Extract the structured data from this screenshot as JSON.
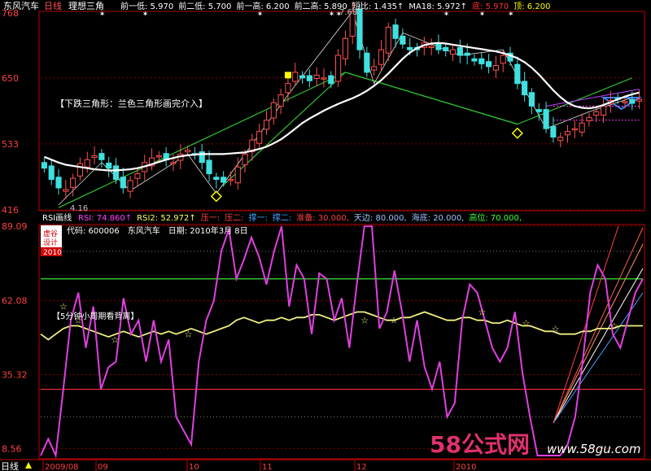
{
  "top_panel": {
    "stock_name": "东风汽车",
    "period": "日线",
    "indicator_name": "理想三角",
    "readouts": [
      {
        "label": "前一低:",
        "value": "5.970",
        "color": "#ffffff"
      },
      {
        "label": "前二低:",
        "value": "5.700",
        "color": "#ffffff"
      },
      {
        "label": "前一高:",
        "value": "6.200",
        "color": "#ffffff"
      },
      {
        "label": "前二高:",
        "value": "5.890",
        "color": "#ffffff"
      },
      {
        "label": "短比:",
        "value": "1.435↑",
        "color": "#ffffff"
      },
      {
        "label": "MA18:",
        "value": "5.972↑",
        "color": "#ffffff"
      },
      {
        "label": "底:",
        "value": "5.970",
        "color": "#ff3030"
      },
      {
        "label": "顶:",
        "value": "6.200",
        "color": "#ffff00"
      }
    ],
    "annotation": "【下跌三角形：兰色三角形画完介入】",
    "high_label": "7.68",
    "low_label": "4.16"
  },
  "bottom_panel": {
    "indicator_name": "RSI画线",
    "readouts": [
      {
        "label": "RSI:",
        "value": "74.860↑",
        "color": "#ff40ff"
      },
      {
        "label": "RSI2:",
        "value": "52.972↑",
        "color": "#ffff60"
      },
      {
        "label": "压一:",
        "value": "",
        "color": "#ff4040"
      },
      {
        "label": "压二:",
        "value": "",
        "color": "#ff4040"
      },
      {
        "label": "撑一:",
        "value": "",
        "color": "#40a0ff"
      },
      {
        "label": "撑二:",
        "value": "",
        "color": "#40a0ff"
      },
      {
        "label": "准备:",
        "value": "30.000,",
        "color": "#ff4040"
      },
      {
        "label": "天边:",
        "value": "80.000,",
        "color": "#a0c0ff"
      },
      {
        "label": "海底:",
        "value": "20.000,",
        "color": "#a0c0ff"
      },
      {
        "label": "高位:",
        "value": "70.000,",
        "color": "#40ff40"
      }
    ],
    "code_line": "代码: 600006　东风汽车　日期: 2010年3月 8日",
    "annotation": "【5分钟小周期看背离】",
    "badge_line1": "虚谷",
    "badge_line2": "设计",
    "badge_year": "2010"
  },
  "watermark": {
    "main": "58公式网",
    "url": "www.58gu.com"
  },
  "footer": {
    "period": "日线",
    "dates": [
      "2009/08",
      "09",
      "10",
      "11",
      "12",
      "2010"
    ]
  },
  "colors": {
    "bull": "#ff5050",
    "bear": "#40e0e0",
    "ma": "#ffffff",
    "rsi": "#e040e0",
    "rsi2": "#f0f080",
    "tri_green": "#30c030",
    "grid_red": "#a00000",
    "axis": "#c00000"
  },
  "chart_data": [
    {
      "type": "candlestick",
      "title": "东风汽车 日线 理想三角",
      "y_axis_ticks": [
        416,
        533,
        650,
        768
      ],
      "ylim": [
        416,
        768
      ],
      "annotations": [
        "7.68",
        "4.16"
      ],
      "series": [
        {
          "name": "MA18",
          "values": [
            510,
            505,
            500,
            496,
            494,
            492,
            490,
            488,
            487,
            486,
            486,
            487,
            488,
            490,
            493,
            497,
            501,
            505,
            508,
            511,
            513,
            514,
            515,
            515,
            515,
            515,
            516,
            517,
            518,
            521,
            524,
            528,
            534,
            541,
            550,
            560,
            570,
            578,
            585,
            592,
            598,
            604,
            609,
            614,
            620,
            627,
            636,
            646,
            658,
            671,
            684,
            695,
            703,
            708,
            711,
            712,
            711,
            709,
            707,
            705,
            703,
            701,
            699,
            697,
            694,
            690,
            685,
            678,
            668,
            656,
            642,
            628,
            616,
            606,
            600,
            597,
            596,
            598,
            602,
            607,
            612,
            617,
            621,
            624
          ]
        },
        {
          "name": "close",
          "values": [
            490,
            470,
            455,
            452,
            472,
            498,
            505,
            512,
            505,
            490,
            470,
            455,
            468,
            480,
            500,
            508,
            512,
            505,
            500,
            515,
            522,
            515,
            500,
            480,
            470,
            465,
            470,
            492,
            515,
            540,
            555,
            575,
            606,
            620,
            640,
            660,
            650,
            645,
            655,
            650,
            640,
            690,
            720,
            768,
            700,
            660,
            670,
            700,
            740,
            720,
            710,
            700,
            700,
            712,
            706,
            700,
            698,
            700,
            690,
            690,
            680,
            675,
            670,
            672,
            690,
            680,
            640,
            620,
            600,
            590,
            560,
            545,
            545,
            555,
            560,
            570,
            580,
            590,
            600,
            610,
            612,
            608,
            605,
            612
          ]
        }
      ]
    },
    {
      "type": "line",
      "title": "RSI画线",
      "y_axis_ticks": [
        8.56,
        35.32,
        62.08,
        89.09
      ],
      "ylim": [
        6,
        89.09
      ],
      "series": [
        {
          "name": "RSI",
          "values": [
            5,
            12,
            2,
            30,
            55,
            65,
            45,
            60,
            30,
            38,
            40,
            63,
            50,
            55,
            40,
            55,
            40,
            48,
            20,
            15,
            10,
            40,
            55,
            62,
            80,
            88,
            70,
            77,
            85,
            78,
            68,
            80,
            89,
            60,
            75,
            70,
            50,
            72,
            70,
            55,
            63,
            45,
            68,
            89,
            90,
            52,
            58,
            73,
            58,
            40,
            55,
            38,
            30,
            40,
            20,
            25,
            55,
            68,
            65,
            55,
            45,
            40,
            45,
            58,
            36,
            20,
            0,
            -5,
            -3,
            0,
            10,
            20,
            40,
            65,
            75,
            70,
            50,
            45,
            55,
            65,
            70
          ]
        },
        {
          "name": "RSI2",
          "values": [
            50,
            48,
            50,
            52,
            53,
            53,
            52,
            51,
            50,
            49,
            50,
            51,
            50,
            49,
            50,
            51,
            50,
            51,
            50,
            51,
            52,
            51,
            50,
            51,
            52,
            53,
            55,
            56,
            55,
            54,
            55,
            55,
            56,
            55,
            56,
            56,
            57,
            57,
            56,
            55,
            56,
            57,
            58,
            58,
            57,
            56,
            55,
            55,
            56,
            56,
            57,
            58,
            57,
            56,
            55,
            55,
            56,
            56,
            55,
            55,
            54,
            54,
            55,
            54,
            53,
            53,
            52,
            51,
            51,
            50,
            50,
            50,
            51,
            51,
            52,
            52,
            52,
            53,
            53,
            53,
            53
          ]
        }
      ],
      "reference_lines": [
        {
          "name": "天边",
          "y": 80
        },
        {
          "name": "高位",
          "y": 70
        },
        {
          "name": "准备",
          "y": 30
        },
        {
          "name": "海底",
          "y": 20
        }
      ]
    }
  ]
}
